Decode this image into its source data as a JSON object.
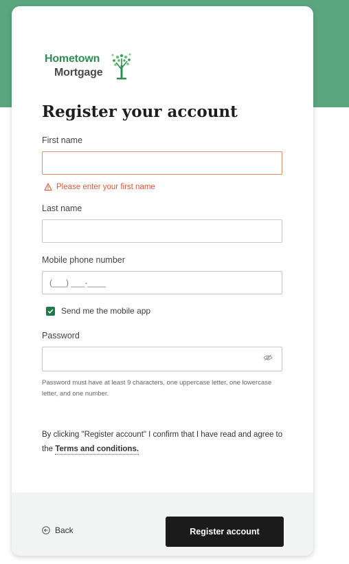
{
  "brand": {
    "name_line1": "Hometown",
    "name_line2": "Mortgage",
    "accent_color": "#5aa77f",
    "logo_icon": "tree-icon"
  },
  "form": {
    "title": "Register your account",
    "first_name": {
      "label": "First name",
      "value": "",
      "error": "Please enter your first name"
    },
    "last_name": {
      "label": "Last name",
      "value": ""
    },
    "phone": {
      "label": "Mobile phone number",
      "placeholder": "(___) ___-____"
    },
    "mobile_app": {
      "label": "Send me the mobile app",
      "checked": true
    },
    "password": {
      "label": "Password",
      "value": "",
      "hint": "Password must have at least 9 characters, one uppercase letter, one lowercase letter, and one number."
    },
    "consent": {
      "text": "By clicking \"Register account\" I confirm that I have read and agree to the",
      "link": "Terms and conditions."
    }
  },
  "footer": {
    "back_label": "Back",
    "register_label": "Register account"
  },
  "colors": {
    "error": "#e0573a",
    "button": "#1b1b1b",
    "checkbox": "#1f7a4a"
  }
}
